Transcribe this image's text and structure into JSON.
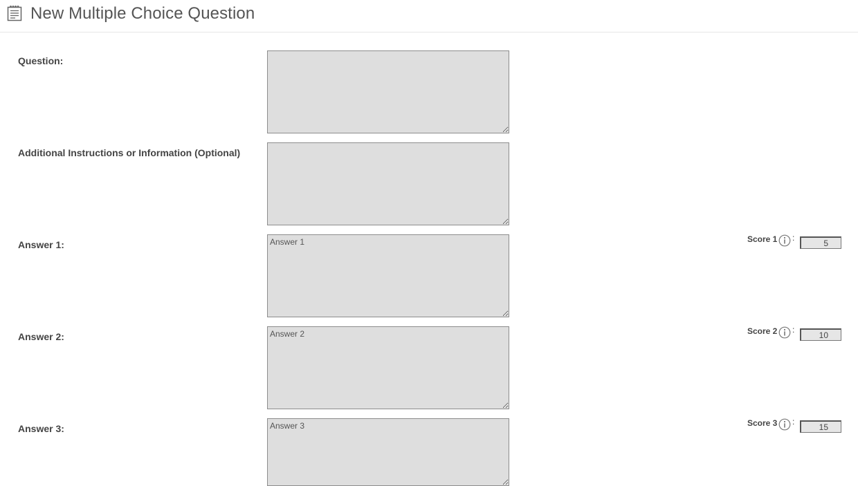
{
  "header": {
    "title": "New Multiple Choice Question",
    "icon": "notepad-icon"
  },
  "form": {
    "question": {
      "label": "Question:",
      "value": "",
      "placeholder": ""
    },
    "instructions": {
      "label": "Additional Instructions or Information (Optional)",
      "value": "",
      "placeholder": ""
    },
    "answers": [
      {
        "label": "Answer 1:",
        "placeholder": "Answer 1",
        "score_label": "Score 1",
        "score_value": "5"
      },
      {
        "label": "Answer 2:",
        "placeholder": "Answer 2",
        "score_label": "Score 2",
        "score_value": "10"
      },
      {
        "label": "Answer 3:",
        "placeholder": "Answer 3",
        "score_label": "Score 3",
        "score_value": "15"
      }
    ],
    "score_separator": ":",
    "info_icon": "info-icon"
  },
  "colors": {
    "field_bg": "#dedede",
    "field_border": "#8c8c8c",
    "label_text": "#444444",
    "title_text": "#555555"
  }
}
